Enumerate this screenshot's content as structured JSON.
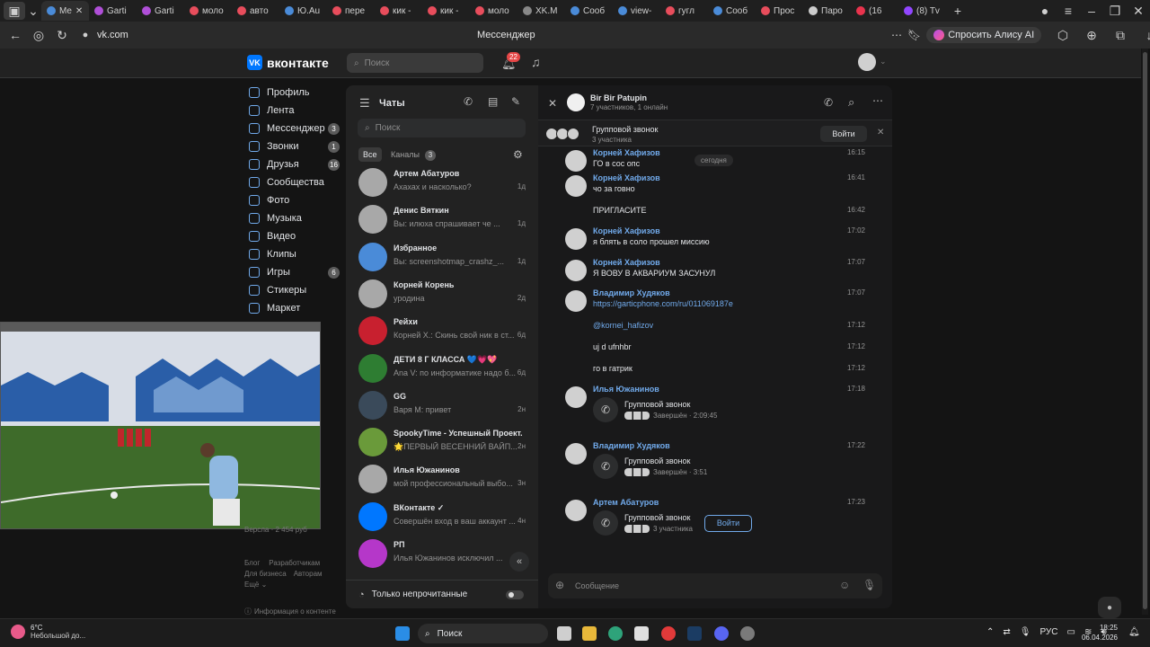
{
  "browser": {
    "tabs": [
      {
        "label": "Me",
        "color": "#4a8bd8"
      },
      {
        "label": "Garti",
        "color": "#b04fd8"
      },
      {
        "label": "Garti",
        "color": "#b04fd8"
      },
      {
        "label": "моло",
        "color": "#e84d5c"
      },
      {
        "label": "авто",
        "color": "#e84d5c"
      },
      {
        "label": "Ю.Au",
        "color": "#4a8bd8"
      },
      {
        "label": "пере",
        "color": "#e84d5c"
      },
      {
        "label": "кик -",
        "color": "#e84d5c"
      },
      {
        "label": "кик -",
        "color": "#e84d5c"
      },
      {
        "label": "моло",
        "color": "#e84d5c"
      },
      {
        "label": "XK.M",
        "color": "#888888"
      },
      {
        "label": "Сооб",
        "color": "#4a8bd8"
      },
      {
        "label": "view-",
        "color": "#4a8bd8"
      },
      {
        "label": "гугл",
        "color": "#e84d5c"
      },
      {
        "label": "Сооб",
        "color": "#4a8bd8"
      },
      {
        "label": "Прос",
        "color": "#e84d5c"
      },
      {
        "label": "Паро",
        "color": "#cccccc"
      },
      {
        "label": "(16",
        "color": "#e8334d"
      },
      {
        "label": "(8) Tv",
        "color": "#9146ff"
      }
    ],
    "url": "vk.com",
    "page_title": "Мессенджер",
    "alice_label": "Спросить Алису AI"
  },
  "vk": {
    "logo": "вконтакте",
    "search_placeholder": "Поиск",
    "notif_count": "22"
  },
  "nav": [
    {
      "label": "Профиль",
      "count": ""
    },
    {
      "label": "Лента",
      "count": ""
    },
    {
      "label": "Мессенджер",
      "count": "3"
    },
    {
      "label": "Звонки",
      "count": "1"
    },
    {
      "label": "Друзья",
      "count": "16"
    },
    {
      "label": "Сообщества",
      "count": ""
    },
    {
      "label": "Фото",
      "count": ""
    },
    {
      "label": "Музыка",
      "count": ""
    },
    {
      "label": "Видео",
      "count": ""
    },
    {
      "label": "Клипы",
      "count": ""
    },
    {
      "label": "Игры",
      "count": "6"
    },
    {
      "label": "Стикеры",
      "count": ""
    },
    {
      "label": "Маркет",
      "count": ""
    }
  ],
  "footer": {
    "links": [
      "Блог",
      "Разработчикам",
      "Для бизнеса",
      "Авторам",
      "Ещё"
    ],
    "info": "Информация о контенте",
    "partial": "Версла · 2 454 руб"
  },
  "chats": {
    "title": "Чаты",
    "search_placeholder": "Поиск",
    "filter_all": "Все",
    "filter_channels": "Каналы",
    "channels_count": "3",
    "unread_only": "Только непрочитанные",
    "items": [
      {
        "name": "Артем Абатуров",
        "preview": "Ахахах и насколько?",
        "time": "1д",
        "color": "#a8a8a8"
      },
      {
        "name": "Денис Вяткин",
        "preview": "Вы: илюха спрашивает че ...",
        "time": "1д",
        "color": "#a8a8a8"
      },
      {
        "name": "Избранное",
        "preview": "Вы: screenshotmap_crashz_...",
        "time": "1д",
        "color": "#4a8bd8"
      },
      {
        "name": "Корней Корень",
        "preview": "уродина",
        "time": "2д",
        "color": "#a8a8a8"
      },
      {
        "name": "Рейхи",
        "preview": "Корней Х.: Скинь свой ник в ст...",
        "time": "6д",
        "color": "#c8202f"
      },
      {
        "name": "ДЕТИ 8 Г КЛАССА 💙💗💖",
        "preview": "Ana V: по информатике надо б...",
        "time": "6д",
        "color": "#2e7d32"
      },
      {
        "name": "GG",
        "preview": "Варя М: привет",
        "time": "2н",
        "color": "#3a4a5a"
      },
      {
        "name": "SpookyTime - Успешный Проект.",
        "preview": "🌟ПЕРВЫЙ ВЕСЕННИЙ ВАЙП...",
        "time": "2н",
        "color": "#6a9a3a"
      },
      {
        "name": "Илья Южанинов",
        "preview": "мой профессиональный выбо...",
        "time": "3н",
        "color": "#a8a8a8"
      },
      {
        "name": "ВКонтакте ✓",
        "preview": "Совершён вход в ваш аккаунт ...",
        "time": "4н",
        "color": "#0077ff"
      },
      {
        "name": "РП",
        "preview": "Илья Южанинов исключил ...",
        "time": "8",
        "color": "#b537c9"
      }
    ]
  },
  "conversation": {
    "title": "Bir Bir Patupin",
    "subtitle": "7 участников, 1 онлайн",
    "group_call_label": "Групповой звонок",
    "group_call_sub": "3 участника",
    "join_label": "Войти",
    "date_divider": "сегодня",
    "input_placeholder": "Сообщение",
    "messages": [
      {
        "name": "Корней Хафизов",
        "text": "ГО в сос опс",
        "time": "16:15"
      },
      {
        "name": "Корней Хафизов",
        "text": "чо за говно",
        "time": "16:41"
      },
      {
        "name": "",
        "text": "ПРИГЛАСИТЕ",
        "time": "16:42"
      },
      {
        "name": "Корней Хафизов",
        "text": "я блять в соло прошел миссию",
        "time": "17:02"
      },
      {
        "name": "Корней Хафизов",
        "text": "Я ВОВУ В АКВАРИУМ ЗАСУНУЛ",
        "time": "17:07"
      },
      {
        "name": "Владимир Худяков",
        "text": "https://garticphone.com/ru/011069187e",
        "time": "17:07"
      },
      {
        "name": "",
        "text": "@kornei_hafizov",
        "time": "17:12"
      },
      {
        "name": "",
        "text": "uj d ufnhbr",
        "time": "17:12"
      },
      {
        "name": "",
        "text": "го в гатрик",
        "time": "17:12"
      },
      {
        "name": "Илья Южанинов",
        "text": "",
        "time": "17:18",
        "call_title": "Групповой звонок",
        "call_sub": "Завершён · 2:09:45"
      },
      {
        "name": "Владимир Худяков",
        "text": "",
        "time": "17:22",
        "call_title": "Групповой звонок",
        "call_sub": "Завершён · 3:51"
      },
      {
        "name": "Артем Абатуров",
        "text": "",
        "time": "17:23",
        "call_title": "Групповой звонок",
        "call_sub": "3 участника"
      }
    ]
  },
  "taskbar": {
    "weather_temp": "6°C",
    "weather_desc": "Небольшой до...",
    "search_label": "Поиск",
    "lang": "РУС",
    "time": "18:25",
    "date": "06.04.2026"
  }
}
